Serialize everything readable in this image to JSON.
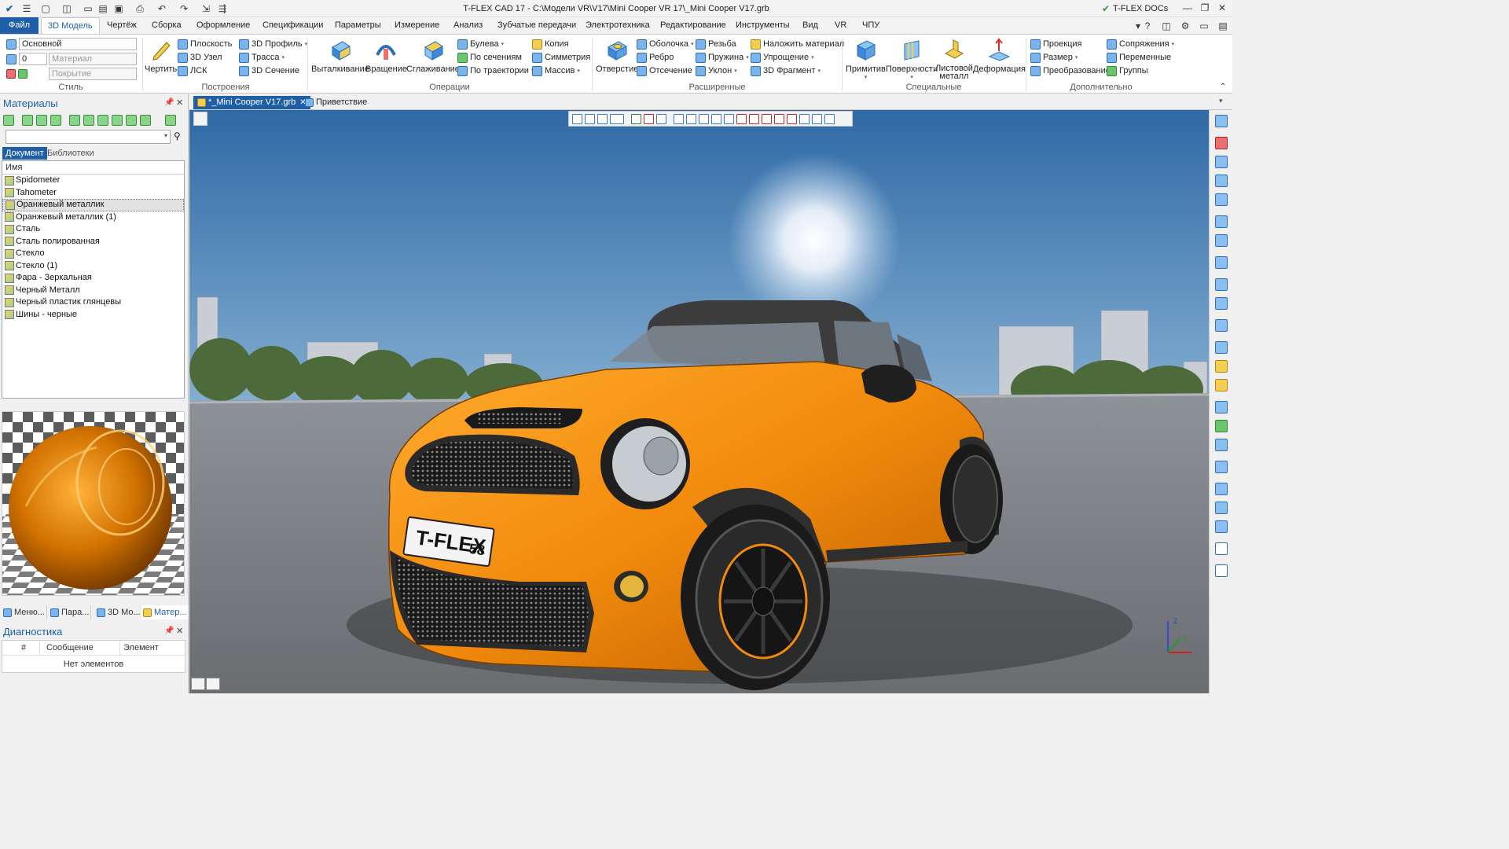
{
  "app_title": "T-FLEX CAD 17 - C:\\Модели VR\\V17\\Mini Cooper VR 17\\_Mini Cooper V17.grb",
  "docs_label": "T-FLEX DOCs",
  "menu": {
    "file": "Файл",
    "tabs": [
      "3D Модель",
      "Чертёж",
      "Сборка",
      "Оформление",
      "Спецификации",
      "Параметры",
      "Измерение",
      "Анализ",
      "Зубчатые передачи",
      "Электротехника",
      "Редактирование",
      "Инструменты",
      "Вид",
      "VR",
      "ЧПУ"
    ]
  },
  "ribbon": {
    "style": {
      "label": "Стиль",
      "layer": "Основной",
      "num": "0",
      "material_ph": "Материал",
      "cover_ph": "Покрытие"
    },
    "construct": {
      "label": "Построения",
      "sketch": "Чертить",
      "plane": "Плоскость",
      "node": "3D Узел",
      "lsk": "ЛСК",
      "profile": "3D Профиль",
      "path": "Трасса",
      "section": "3D Сечение"
    },
    "ops": {
      "label": "Операции",
      "extrude": "Выталкивание",
      "revolve": "Вращение",
      "smooth": "Сглаживание",
      "boolean": "Булева",
      "by_sections": "По сечениям",
      "by_path": "По траектории",
      "copy": "Копия",
      "symmetry": "Симметрия",
      "array": "Массив"
    },
    "adv": {
      "label": "Расширенные",
      "hole": "Отверстие",
      "shell": "Оболочка",
      "rib": "Ребро",
      "cut": "Отсечение",
      "thread": "Резьба",
      "spring": "Пружина",
      "slope": "Уклон",
      "apply_mat": "Наложить материал",
      "simplify": "Упрощение",
      "fragment": "3D Фрагмент"
    },
    "special": {
      "label": "Специальные",
      "primitives": "Примитив",
      "surfaces": "Поверхности",
      "sheet": "Листовой металл",
      "deform": "Деформация"
    },
    "extra": {
      "label": "Дополнительно",
      "projection": "Проекция",
      "size": "Размер",
      "transform": "Преобразование",
      "mates": "Сопряжения",
      "variables": "Переменные",
      "groups": "Группы"
    }
  },
  "materials_panel": {
    "title": "Материалы",
    "tab_doc": "Документ",
    "tab_lib": "Библиотеки",
    "col_name": "Имя",
    "items": [
      "Spidometer",
      "Tahometer",
      "Оранжевый металлик",
      "Оранжевый металлик (1)",
      "Сталь",
      "Сталь полированная",
      "Стекло",
      "Стекло (1)",
      "Фара - Зеркальная",
      "Черный Металл",
      "Черный пластик глянцевы",
      "Шины - черные"
    ],
    "selected_index": 2
  },
  "bottom_tabs": [
    "Меню...",
    "Пара...",
    "3D Мо...",
    "Матер..."
  ],
  "diagnostics": {
    "title": "Диагностика",
    "cols": [
      "#",
      "Сообщение",
      "Элемент"
    ],
    "empty": "Нет элементов"
  },
  "doc_tabs": {
    "active": "*_Mini Cooper V17.grb",
    "other": "Приветствие"
  },
  "plate": {
    "text": "T-FLEX",
    "num": "58"
  },
  "colors": {
    "accent": "#1e5fa8",
    "car_body": "#f28a0c"
  }
}
